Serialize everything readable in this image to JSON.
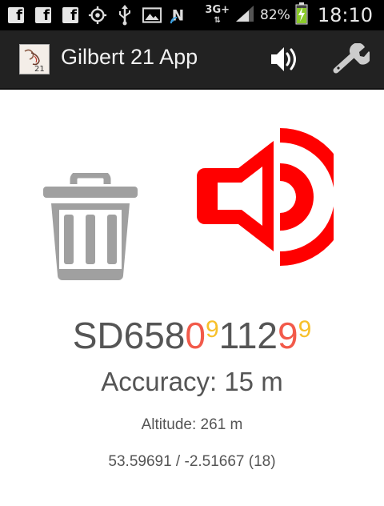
{
  "status_bar": {
    "notification_icons": [
      "facebook-icon",
      "facebook-icon",
      "facebook-icon",
      "gps-icon",
      "usb-icon",
      "image-icon",
      "nfc-icon"
    ],
    "network": "3G+",
    "battery_percent": "82%",
    "battery_level": 0.82,
    "time": "18:10"
  },
  "action_bar": {
    "title": "Gilbert 21 App",
    "logo_text": "21"
  },
  "location": {
    "grid_prefix": "SD658",
    "easting_red": "0",
    "easting_yellow": "9",
    "northing_main": "112",
    "northing_red": "9",
    "northing_yellow": "9",
    "accuracy": "Accuracy: 15 m",
    "altitude": "Altitude: 261 m",
    "coordinates": "53.59691 / -2.51667 (18)"
  },
  "colors": {
    "speaker_red": "#ff0000",
    "trash_gray": "#a0a0a0",
    "digit_red": "#f25a4a",
    "digit_yellow": "#f7c02a",
    "text_gray": "#555555",
    "action_bar": "#222222"
  }
}
